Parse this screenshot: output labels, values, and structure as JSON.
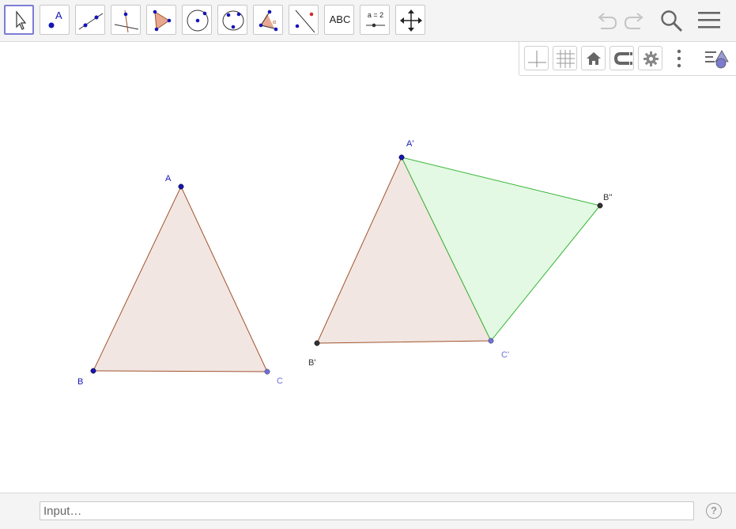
{
  "toolbar": {
    "tools": [
      {
        "name": "move-tool",
        "active": true
      },
      {
        "name": "point-tool",
        "active": false
      },
      {
        "name": "line-tool",
        "active": false
      },
      {
        "name": "perpendicular-line-tool",
        "active": false
      },
      {
        "name": "polygon-tool",
        "active": false
      },
      {
        "name": "circle-tool",
        "active": false
      },
      {
        "name": "conic-tool",
        "active": false
      },
      {
        "name": "angle-tool",
        "active": false
      },
      {
        "name": "reflect-tool",
        "active": false
      },
      {
        "name": "text-tool",
        "active": false
      },
      {
        "name": "slider-tool",
        "active": false
      },
      {
        "name": "move-graphics-view-tool",
        "active": false
      }
    ],
    "point_tool_label": "A",
    "text_tool_label": "ABC",
    "slider_tool_label": "a = 2",
    "right_icons": [
      "undo-icon",
      "redo-icon",
      "search-icon",
      "menu-icon"
    ]
  },
  "graphics_toolbar": {
    "buttons": [
      "axes-icon",
      "grid-icon",
      "home-icon",
      "magnet-icon",
      "gear-icon",
      "more-vert-icon",
      "style-bar-toggle-icon"
    ]
  },
  "canvas": {
    "point_labels": {
      "A": "A",
      "B": "B",
      "C": "C",
      "A_prime": "A'",
      "B_prime": "B'",
      "C_prime": "C'",
      "B_double_prime": "B''"
    }
  },
  "colors": {
    "triangle_fill": "#f2e6e2",
    "triangle_stroke": "#a0522d",
    "green_fill": "#e3f9e3",
    "green_stroke": "#39b539",
    "point_blue": "#1515b5",
    "point_light_blue": "#6f6fe0",
    "point_dark": "#333333",
    "active_tool_border": "#7d7dd6"
  },
  "input_bar": {
    "placeholder": "Input…"
  }
}
